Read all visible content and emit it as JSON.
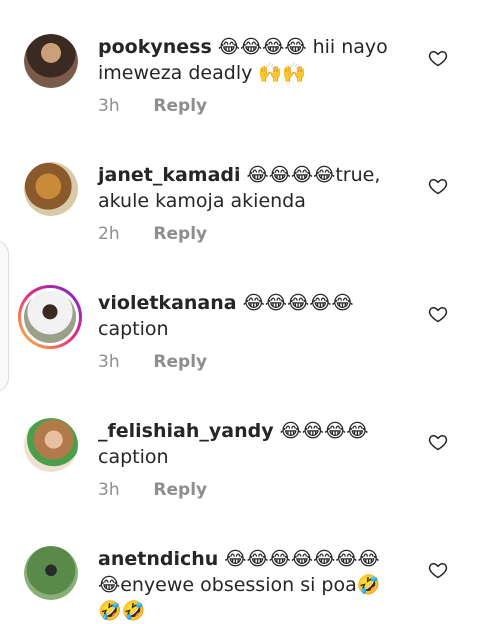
{
  "comments": [
    {
      "username": "pookyness",
      "text": "😂😂😂😂 hii nayo imeweza deadly 🙌🙌",
      "time": "3h",
      "reply_label": "Reply"
    },
    {
      "username": "janet_kamadi",
      "text": "😂😂😂😂true, akule kamoja akienda",
      "time": "2h",
      "reply_label": "Reply"
    },
    {
      "username": "violetkanana",
      "text": "😂😂😂😂😂 caption",
      "time": "3h",
      "reply_label": "Reply"
    },
    {
      "username": "_felishiah_yandy",
      "text": "😂😂😂😂 caption",
      "time": "3h",
      "reply_label": "Reply"
    },
    {
      "username": "anetndichu",
      "text": "😂😂😂😂😂😂😂 😂enyewe obsession si poa🤣 🤣🤣",
      "time": "",
      "reply_label": ""
    }
  ],
  "colors": {
    "text": "#262626",
    "muted": "#8e8e8e"
  },
  "icons": {
    "like": "heart-outline-icon"
  }
}
